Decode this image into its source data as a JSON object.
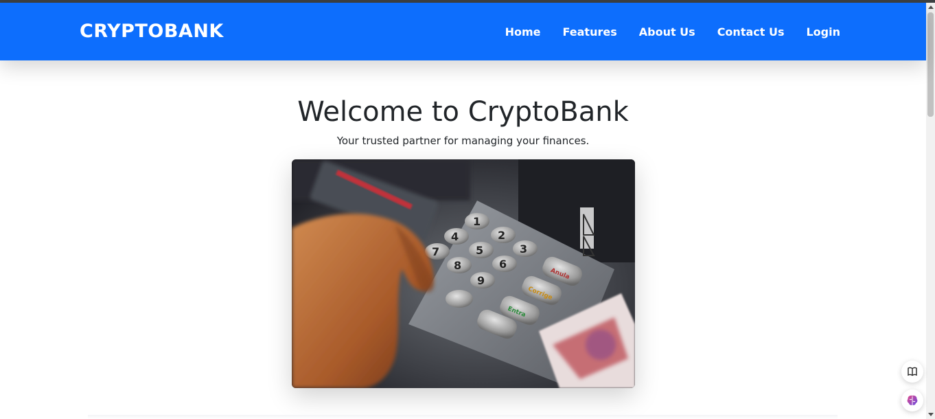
{
  "navbar": {
    "brand": "CRYPTOBANK",
    "links": [
      {
        "label": "Home"
      },
      {
        "label": "Features"
      },
      {
        "label": "About Us"
      },
      {
        "label": "Contact Us"
      },
      {
        "label": "Login"
      }
    ]
  },
  "hero": {
    "title": "Welcome to CryptoBank",
    "subtitle": "Your trusted partner for managing your finances.",
    "image": {
      "subject": "hand pressing ATM keypad",
      "keypad_labels": [
        "1",
        "2",
        "3",
        "4",
        "5",
        "6",
        "7",
        "8",
        "9",
        "Anula",
        "Corrige",
        "Entra"
      ]
    }
  },
  "floating_buttons": [
    {
      "icon": "book-icon"
    },
    {
      "icon": "brain-icon"
    }
  ],
  "colors": {
    "navbar": "#0d6efd",
    "text": "#212529"
  }
}
